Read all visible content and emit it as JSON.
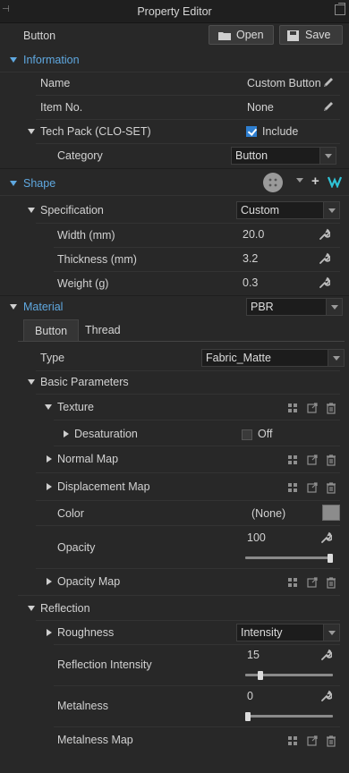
{
  "window": {
    "title": "Property Editor"
  },
  "header": {
    "object_label": "Button",
    "open_label": "Open",
    "save_label": "Save"
  },
  "information": {
    "title": "Information",
    "name_label": "Name",
    "name_value": "Custom Button",
    "item_no_label": "Item No.",
    "item_no_value": "None",
    "techpack_label": "Tech Pack (CLO-SET)",
    "include_label": "Include",
    "include_checked": true,
    "category_label": "Category",
    "category_value": "Button"
  },
  "shape": {
    "title": "Shape",
    "spec_label": "Specification",
    "spec_value": "Custom",
    "width_label": "Width (mm)",
    "width_value": "20.0",
    "thickness_label": "Thickness (mm)",
    "thickness_value": "3.2",
    "weight_label": "Weight (g)",
    "weight_value": "0.3"
  },
  "material": {
    "title": "Material",
    "render_value": "PBR",
    "tabs": [
      "Button",
      "Thread"
    ],
    "type_label": "Type",
    "type_value": "Fabric_Matte",
    "basic_label": "Basic Parameters",
    "texture_label": "Texture",
    "desat_label": "Desaturation",
    "desat_value": "Off",
    "normal_label": "Normal Map",
    "displacement_label": "Displacement Map",
    "color_label": "Color",
    "color_value": "(None)",
    "color_swatch": "#8c8c8c",
    "opacity_label": "Opacity",
    "opacity_value": "100",
    "opacity_fraction": 1.0,
    "opacity_map_label": "Opacity Map",
    "reflection_label": "Reflection",
    "roughness_label": "Roughness",
    "roughness_value": "Intensity",
    "refl_int_label": "Reflection Intensity",
    "refl_int_value": "15",
    "refl_int_fraction": 0.15,
    "metal_label": "Metalness",
    "metal_value": "0",
    "metal_fraction": 0.0,
    "metal_map_label": "Metalness Map"
  },
  "colors": {
    "accent": "#5fa8e0",
    "panel": "#282828"
  }
}
